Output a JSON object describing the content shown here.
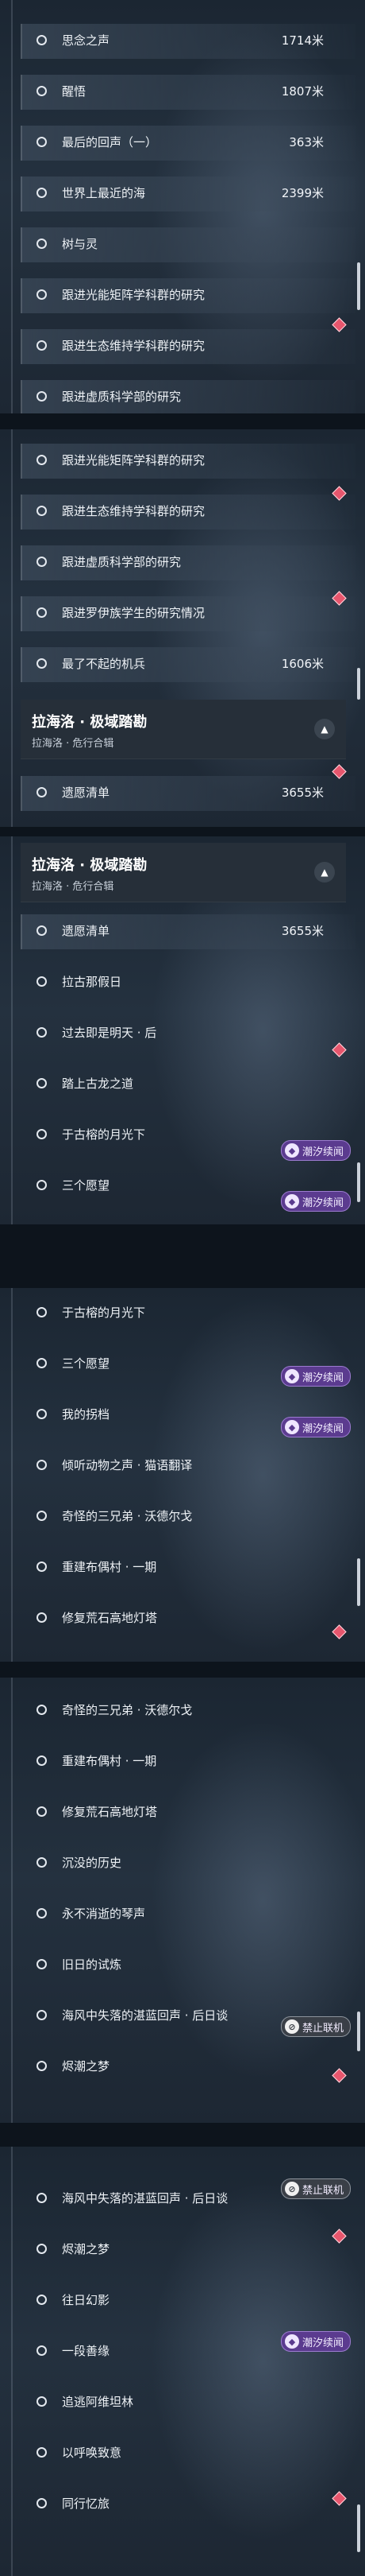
{
  "quests": {
    "s1_1": {
      "title": "思念之声",
      "distance": "1714米"
    },
    "s1_2": {
      "title": "醒悟",
      "distance": "1807米"
    },
    "s1_3": {
      "title": "最后的回声（一）",
      "distance": "363米"
    },
    "s1_4": {
      "title": "世界上最近的海",
      "distance": "2399米"
    },
    "s1_5": {
      "title": "树与灵"
    },
    "s1_6": {
      "title": "跟进光能矩阵学科群的研究"
    },
    "s1_7": {
      "title": "跟进生态维持学科群的研究"
    },
    "s1_8": {
      "title": "跟进虚质科学部的研究"
    },
    "s2_1": {
      "title": "跟进光能矩阵学科群的研究"
    },
    "s2_2": {
      "title": "跟进生态维持学科群的研究"
    },
    "s2_3": {
      "title": "跟进虚质科学部的研究"
    },
    "s2_4": {
      "title": "跟进罗伊族学生的研究情况"
    },
    "s2_5": {
      "title": "最了不起的机兵",
      "distance": "1606米"
    },
    "s2_6": {
      "title": "遗愿清单",
      "distance": "3655米"
    },
    "s3_1": {
      "title": "遗愿清单",
      "distance": "3655米"
    },
    "s3_2": {
      "title": "拉古那假日"
    },
    "s3_3": {
      "title": "过去即是明天 · 后"
    },
    "s3_4": {
      "title": "踏上古龙之道"
    },
    "s3_5": {
      "title": "于古榕的月光下"
    },
    "s3_6": {
      "title": "三个愿望"
    },
    "s4_1": {
      "title": "于古榕的月光下"
    },
    "s4_2": {
      "title": "三个愿望"
    },
    "s4_3": {
      "title": "我的拐档"
    },
    "s4_4": {
      "title": "倾听动物之声 · 猫语翻译"
    },
    "s4_5": {
      "title": "奇怪的三兄弟 · 沃德尔戈"
    },
    "s4_6": {
      "title": "重建布偶村 · 一期"
    },
    "s4_7": {
      "title": "修复荒石高地灯塔"
    },
    "s5_1": {
      "title": "奇怪的三兄弟 · 沃德尔戈"
    },
    "s5_2": {
      "title": "重建布偶村 · 一期"
    },
    "s5_3": {
      "title": "修复荒石高地灯塔"
    },
    "s5_4": {
      "title": "沉没的历史"
    },
    "s5_5": {
      "title": "永不消逝的琴声"
    },
    "s5_6": {
      "title": "旧日的试炼"
    },
    "s5_7": {
      "title": "海风中失落的湛蓝回声 · 后日谈"
    },
    "s5_8": {
      "title": "烬潮之梦"
    },
    "s6_1": {
      "title": "海风中失落的湛蓝回声 · 后日谈"
    },
    "s6_2": {
      "title": "烬潮之梦"
    },
    "s6_3": {
      "title": "往日幻影"
    },
    "s6_4": {
      "title": "一段善缘"
    },
    "s6_5": {
      "title": "追逃阿维坦林"
    },
    "s6_6": {
      "title": "以呼唤致意"
    },
    "s6_7": {
      "title": "同行忆旅"
    }
  },
  "group_header": {
    "title": "拉海洛 · 极域踏勘",
    "subtitle": "拉海洛 · 危行合辑"
  },
  "badges": {
    "tide": "潮汐续闻",
    "no_coop": "禁止联机"
  },
  "icons": {
    "collapse": "chevron-up-icon",
    "tracked": "diamond-icon",
    "badge": "tide-icon"
  },
  "colors": {
    "accent_diamond": "#e7566d",
    "badge_purple": "#5b3b8f"
  }
}
